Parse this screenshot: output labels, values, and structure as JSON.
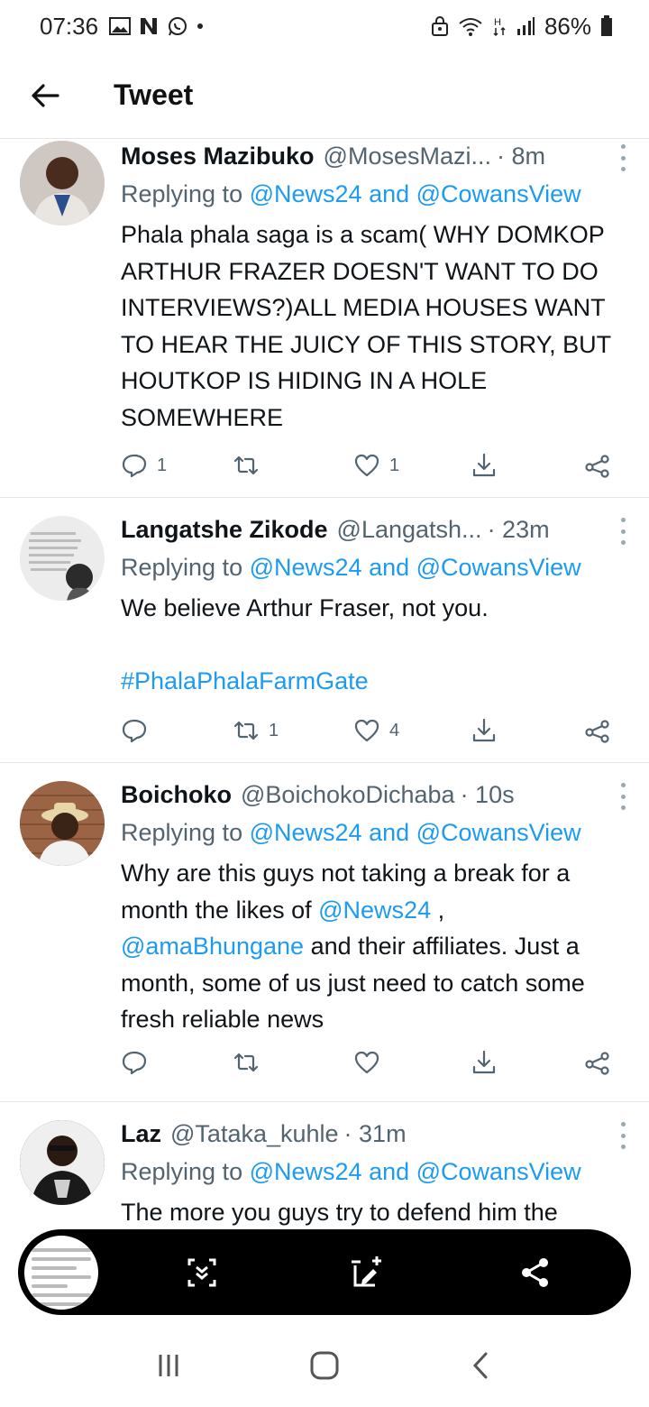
{
  "status_bar": {
    "time": "07:36",
    "battery": "86%",
    "icons_left": [
      "gallery-icon",
      "netflix-icon",
      "whatsapp-icon",
      "dot-icon"
    ],
    "icons_right": [
      "lock-icon",
      "wifi-icon",
      "h-plus-icon",
      "signal-icon",
      "battery-icon"
    ]
  },
  "header": {
    "title": "Tweet",
    "back_icon": "arrow-left-icon"
  },
  "tweets": [
    {
      "name": "Moses Mazibuko",
      "handle": "@MosesMazi...",
      "time": "· 8m",
      "replying_prefix": "Replying to",
      "replying_to": "@News24 and @CowansView",
      "body": "Phala phala saga is a scam( WHY DOMKOP ARTHUR FRAZER DOESN'T WANT TO DO INTERVIEWS?)ALL MEDIA HOUSES WANT TO HEAR THE JUICY OF THIS STORY, BUT HOUTKOP IS HIDING IN A HOLE SOMEWHERE",
      "replies": "1",
      "retweets": "",
      "likes": "1"
    },
    {
      "name": "Langatshe Zikode",
      "handle": "@Langatsh...",
      "time": "· 23m",
      "replying_prefix": "Replying to",
      "replying_to": "@News24 and @CowansView",
      "body": "We believe Arthur Fraser, not you.",
      "hashtag": "#PhalaPhalaFarmGate",
      "replies": "",
      "retweets": "1",
      "likes": "4"
    },
    {
      "name": "Boichoko",
      "handle": "@BoichokoDichaba",
      "time": "· 10s",
      "replying_prefix": "Replying to",
      "replying_to": "@News24 and @CowansView",
      "body_part1": "Why are this guys not taking a break for a month the likes of ",
      "mention1": "@News24",
      "body_part2": " ,",
      "mention2": "@amaBhungane",
      "body_part3": " and their affiliates. Just a month,  some of us just need to catch some fresh reliable news",
      "replies": "",
      "retweets": "",
      "likes": ""
    },
    {
      "name": "Laz",
      "handle": "@Tataka_kuhle",
      "time": "· 31m",
      "replying_prefix": "Replying to",
      "replying_to": "@News24 and @CowansView",
      "body": "The more you guys try to defend him the"
    }
  ],
  "screenshot_toolbar": {
    "buttons": [
      "scroll-capture-icon",
      "edit-icon",
      "share-icon"
    ]
  },
  "nav_bar": {
    "buttons": [
      "recent-apps-icon",
      "home-icon",
      "back-icon"
    ]
  },
  "colors": {
    "link": "#1d9bf0",
    "secondary_text": "#536471",
    "primary_text": "#0f1419"
  }
}
